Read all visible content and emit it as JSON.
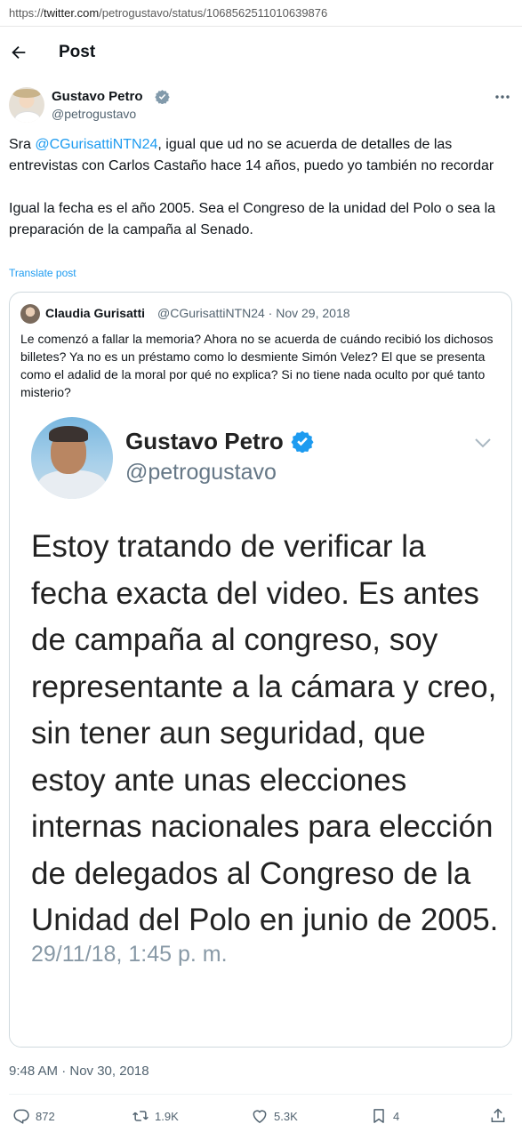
{
  "browser": {
    "url_prefix": "https://",
    "url_domain": "twitter.com",
    "url_path": "/petrogustavo/status/1068562511010639876"
  },
  "header": {
    "title": "Post"
  },
  "tweet": {
    "author_name": "Gustavo Petro",
    "author_handle": "@petrogustavo",
    "text_p1_start": "Sra ",
    "text_p1_mention": "@CGurisattiNTN24",
    "text_p1_end": ", igual que ud no se acuerda de detalles de las entrevistas con Carlos Castaño hace 14 años, puedo yo también no recordar",
    "text_p2": "Igual la fecha es el año 2005. Sea el Congreso de la unidad del Polo o sea la preparación de la campaña al Senado.",
    "translate_label": "Translate post",
    "timestamp": "9:48 AM · Nov 30, 2018"
  },
  "quote": {
    "author_name": "Claudia Gurisatti",
    "meta": "@CGurisattiNTN24 · Nov 29, 2018",
    "text": "Le comenzó a fallar la memoria? Ahora no se acuerda de cuándo recibió los dichosos billetes? Ya no es un préstamo como lo desmiente Simón Velez? El que se presenta como el adalid de la moral por qué no explica? Si no tiene nada oculto por qué tanto misterio?",
    "image": {
      "name": "Gustavo Petro",
      "handle": "@petrogustavo",
      "text": "Estoy tratando de verificar la fecha exacta del video. Es antes de campaña al congreso, soy representante a la cámara y creo, sin tener aun seguridad, que estoy ante unas elecciones internas nacionales para elección de delegados al Congreso de la Unidad del Polo en junio de 2005.",
      "date": "29/11/18, 1:45 p. m."
    }
  },
  "actions": {
    "replies": "872",
    "retweets": "1.9K",
    "likes": "5.3K",
    "bookmarks": "4"
  },
  "icons": [
    "back-arrow-icon",
    "verified-badge-icon",
    "more-options-icon",
    "chevron-down-icon",
    "reply-icon",
    "retweet-icon",
    "like-icon",
    "bookmark-icon",
    "share-icon"
  ],
  "colors": {
    "accent": "#1d9bf0",
    "secondary_text": "#536471",
    "border": "#cfd9de"
  }
}
